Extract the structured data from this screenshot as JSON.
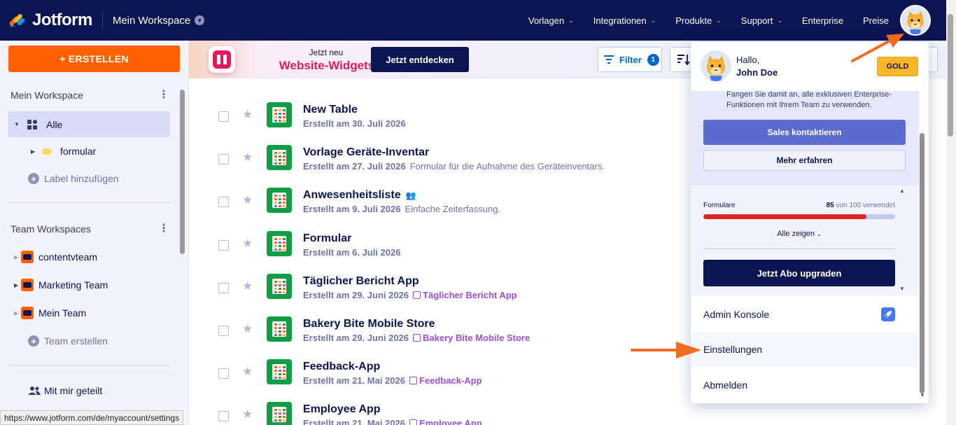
{
  "brand": {
    "name": "Jotform"
  },
  "topnav": {
    "workspace": "Mein Workspace",
    "links": [
      {
        "label": "Vorlagen",
        "caret": true
      },
      {
        "label": "Integrationen",
        "caret": true
      },
      {
        "label": "Produkte",
        "caret": true
      },
      {
        "label": "Support",
        "caret": true
      },
      {
        "label": "Enterprise",
        "caret": false
      },
      {
        "label": "Preise",
        "caret": false
      }
    ]
  },
  "sidebar": {
    "create_label": "+ ERSTELLEN",
    "my_workspace_heading": "Mein Workspace",
    "all_label": "Alle",
    "folder_label": "formular",
    "add_label": "Label hinzufügen",
    "team_heading": "Team Workspaces",
    "teams": [
      "contentvteam",
      "Marketing Team",
      "Mein Team"
    ],
    "create_team": "Team erstellen",
    "shared_with_me": "Mit mir geteilt"
  },
  "status_url": "https://www.jotform.com/de/myaccount/settings",
  "banner": {
    "kicker": "Jetzt neu",
    "title": "Website-Widgets",
    "cta": "Jetzt entdecken",
    "filter_label": "Filter",
    "filter_count": "1"
  },
  "items": [
    {
      "title": "New Table",
      "date": "Erstellt am 30. Juli 2026",
      "desc": "",
      "app": "",
      "shared": false,
      "app_icon": false
    },
    {
      "title": "Vorlage Geräte-Inventar",
      "date": "Erstellt am 27. Juli 2026",
      "desc": "Formular für die Aufnahme des Geräteinventars.",
      "app": "",
      "shared": false,
      "app_icon": false
    },
    {
      "title": "Anwesenheitsliste",
      "date": "Erstellt am 9. Juli 2026",
      "desc": "Einfache Zeiterfassung.",
      "app": "",
      "shared": true,
      "app_icon": false
    },
    {
      "title": "Formular",
      "date": "Erstellt am 6. Juli 2026",
      "desc": "",
      "app": "",
      "shared": false,
      "app_icon": false
    },
    {
      "title": "Täglicher Bericht App",
      "date": "Erstellt am 29. Juni 2026",
      "desc": "",
      "app": "Täglicher Bericht App",
      "shared": false,
      "app_icon": true
    },
    {
      "title": "Bakery Bite Mobile Store",
      "date": "Erstellt am 29. Juni 2026",
      "desc": "",
      "app": "Bakery Bite Mobile Store",
      "shared": false,
      "app_icon": true
    },
    {
      "title": "Feedback-App",
      "date": "Erstellt am 21. Mai 2026",
      "desc": "",
      "app": "Feedback-App",
      "shared": false,
      "app_icon": true
    },
    {
      "title": "Employee App",
      "date": "Erstellt am 21. Mai 2026",
      "desc": "",
      "app": "Employee App",
      "shared": false,
      "app_icon": true
    }
  ],
  "account": {
    "hello": "Hallo,",
    "name": "John Doe",
    "plan": "GOLD",
    "enterprise_text": "Fangen Sie damit an, alle exklusiven Enterprise-Funktionen mit Ihrem Team zu verwenden.",
    "sales_cta": "Sales kontaktieren",
    "learn_more": "Mehr erfahren",
    "usage_label": "Formulare",
    "usage_used": "85",
    "usage_rest": "von 100 verwendet",
    "usage_fraction": 0.85,
    "show_all": "Alle zeigen",
    "upgrade": "Jetzt Abo upgraden",
    "menu": [
      "Admin Konsole",
      "Einstellungen",
      "Abmelden"
    ]
  },
  "colors": {
    "navy": "#0a1551",
    "orange": "#ff6100",
    "usage_red": "#dc2626",
    "gold": "#ffb629",
    "app_purple": "#9c4dd3"
  }
}
